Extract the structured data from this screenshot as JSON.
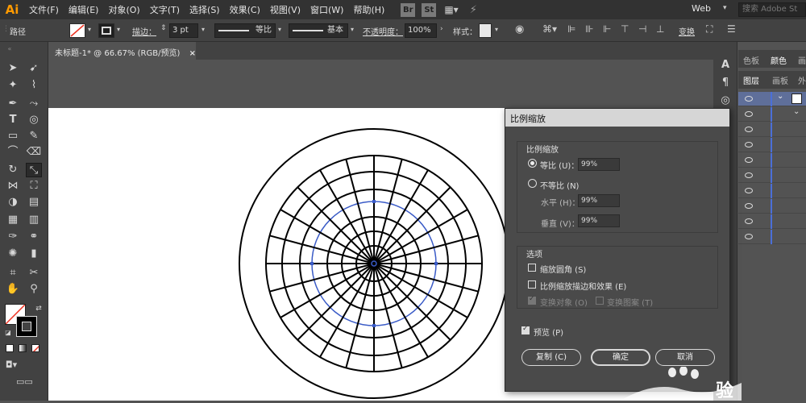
{
  "app": {
    "logo": "Ai",
    "menus": [
      "文件(F)",
      "编辑(E)",
      "对象(O)",
      "文字(T)",
      "选择(S)",
      "效果(C)",
      "视图(V)",
      "窗口(W)",
      "帮助(H)"
    ],
    "bridge_badge": "Br",
    "stock_badge": "St",
    "workspace": "Web",
    "search_placeholder": "搜索 Adobe St"
  },
  "controlbar": {
    "selection_type": "路径",
    "stroke_label": "描边：",
    "stroke_weight": "3 pt",
    "profile_label": "等比",
    "brush_label": "基本",
    "opacity_label": "不透明度：",
    "opacity_value": "100%",
    "style_label": "样式：",
    "transform_label": "变换"
  },
  "document": {
    "tab_title": "未标题-1* @ 66.67% (RGB/预览)",
    "close_symbol": "×"
  },
  "panels": {
    "top_tabs": [
      "色板",
      "颜色",
      "画"
    ],
    "layer_tabs": [
      "图层",
      "画板",
      "外"
    ]
  },
  "dialog": {
    "title": "比例缩放",
    "section_scale": "比例缩放",
    "uniform_label": "等比 (U)：",
    "uniform_value": "99%",
    "nonuniform_label": "不等比 (N)",
    "horizontal_label": "水平 (H)：",
    "horizontal_value": "99%",
    "vertical_label": "垂直 (V)：",
    "vertical_value": "99%",
    "section_options": "选项",
    "scale_corners": "缩放圆角 (S)",
    "scale_strokes": "比例缩放描边和效果 (E)",
    "transform_objects": "变换对象 (O)",
    "transform_patterns": "变换图案 (T)",
    "preview": "预览 (P)",
    "copy_button": "复制 (C)",
    "ok_button": "确定",
    "cancel_button": "取消"
  },
  "colors": {
    "accent_blue": "#4b6fd8",
    "selection_path": "#3a5bc7",
    "layer_color_bar": "#4b6fd8"
  },
  "watermark": "验"
}
